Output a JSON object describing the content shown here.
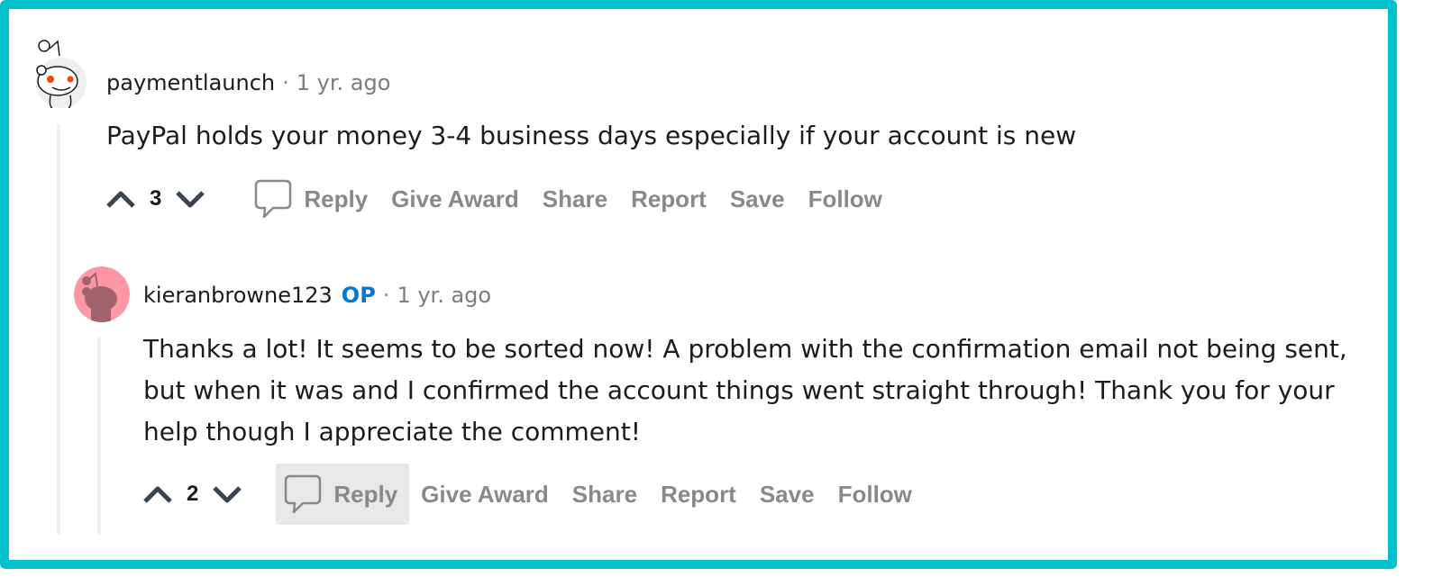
{
  "frame_color": "#00c2cf",
  "comments": [
    {
      "username": "paymentlaunch",
      "op_badge": "",
      "separator": "·",
      "time": "1 yr. ago",
      "body": "PayPal holds your money 3-4 business days especially if your account is new",
      "score": "3",
      "actions": [
        "Reply",
        "Give Award",
        "Share",
        "Report",
        "Save",
        "Follow"
      ],
      "avatar": "snoo-white-avatar"
    },
    {
      "username": "kieranbrowne123",
      "op_badge": "OP",
      "separator": "·",
      "time": "1 yr. ago",
      "body_lines": [
        "Thanks a lot! It seems to be sorted now! A problem with the confirmation email not being sent,",
        "but when it was and I confirmed the account things went straight through! Thank you for your",
        "help though I appreciate the comment!"
      ],
      "score": "2",
      "actions": [
        "Reply",
        "Give Award",
        "Share",
        "Report",
        "Save",
        "Follow"
      ],
      "avatar": "snoo-pink-avatar",
      "reply_highlighted": true
    }
  ],
  "colors": {
    "op": "#0079d3",
    "action_text": "#878a8c",
    "thread_line": "#edeff1",
    "reply_hover_bg": "#e8e8e8"
  }
}
